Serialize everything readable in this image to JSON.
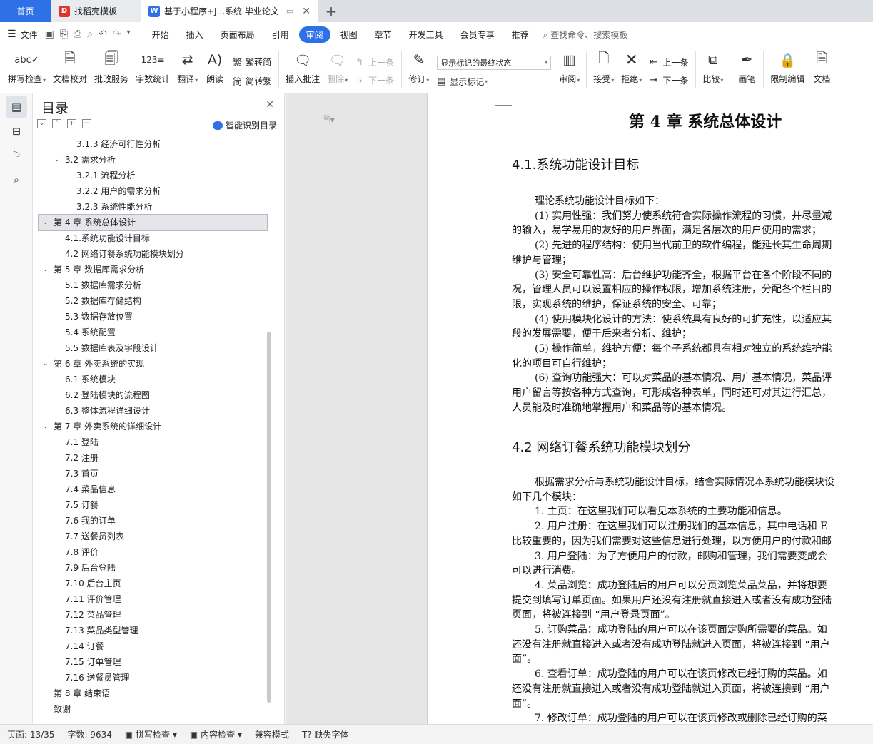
{
  "tabs": [
    {
      "label": "首页"
    },
    {
      "label": "找稻壳模板"
    },
    {
      "label": "基于小程序+J...系统 毕业论文"
    }
  ],
  "menu": {
    "file": "文件",
    "items": [
      "开始",
      "插入",
      "页面布局",
      "引用",
      "审阅",
      "视图",
      "章节",
      "开发工具",
      "会员专享",
      "推荐"
    ],
    "active": "审阅",
    "search": "查找命令、搜索模板"
  },
  "ribbon": {
    "spell": "拼写检查",
    "proof": "文档校对",
    "annotate_service": "批改服务",
    "word_count": "字数统计",
    "translate": "翻译",
    "read": "朗读",
    "trad": "繁转简",
    "simp": "简转繁",
    "insert_comment": "插入批注",
    "delete": "删除",
    "prev1": "上一条",
    "next1": "下一条",
    "revise": "修订",
    "show_markup_select": "显示标记的最终状态",
    "show_markup": "显示标记",
    "review": "审阅",
    "accept": "接受",
    "reject": "拒绝",
    "prev2": "上一条",
    "next2": "下一条",
    "compare": "比较",
    "pen": "画笔",
    "restrict": "限制编辑",
    "doc_more": "文档"
  },
  "toc": {
    "title": "目录",
    "smart": "智能识别目录",
    "items": [
      {
        "label": "3.1.3 经济可行性分析",
        "level": 3
      },
      {
        "label": "3.2 需求分析",
        "level": 2,
        "caret": true
      },
      {
        "label": "3.2.1 流程分析",
        "level": 3
      },
      {
        "label": "3.2.2 用户的需求分析",
        "level": 3
      },
      {
        "label": "3.2.3 系统性能分析",
        "level": 3
      },
      {
        "label": "第 4 章  系统总体设计",
        "level": 1,
        "caret": true,
        "selected": true
      },
      {
        "label": "4.1.系统功能设计目标",
        "level": 2
      },
      {
        "label": "4.2  网络订餐系统功能模块划分",
        "level": 2
      },
      {
        "label": "第 5 章  数据库需求分析",
        "level": 1,
        "caret": true
      },
      {
        "label": "5.1 数据库需求分析",
        "level": 2
      },
      {
        "label": "5.2 数据库存储结构",
        "level": 2
      },
      {
        "label": "5.3  数据存放位置",
        "level": 2
      },
      {
        "label": "5.4  系统配置",
        "level": 2
      },
      {
        "label": "5.5 数据库表及字段设计",
        "level": 2
      },
      {
        "label": "第 6 章  外卖系统的实现",
        "level": 1,
        "caret": true
      },
      {
        "label": "6.1 系统模块",
        "level": 2
      },
      {
        "label": "6.2  登陆模块的流程图",
        "level": 2
      },
      {
        "label": "6.3  整体流程详细设计",
        "level": 2
      },
      {
        "label": "第 7 章  外卖系统的详细设计",
        "level": 1,
        "caret": true
      },
      {
        "label": "7.1 登陆",
        "level": 2
      },
      {
        "label": "7.2 注册",
        "level": 2
      },
      {
        "label": "7.3 首页",
        "level": 2
      },
      {
        "label": "7.4 菜品信息",
        "level": 2
      },
      {
        "label": "7.5 订餐",
        "level": 2
      },
      {
        "label": "7.6 我的订单",
        "level": 2
      },
      {
        "label": "7.7 送餐员列表",
        "level": 2
      },
      {
        "label": "7.8 评价",
        "level": 2
      },
      {
        "label": "7.9  后台登陆",
        "level": 2
      },
      {
        "label": "7.10  后台主页",
        "level": 2
      },
      {
        "label": "7.11 评价管理",
        "level": 2
      },
      {
        "label": "7.12 菜品管理",
        "level": 2
      },
      {
        "label": "7.13 菜品类型管理",
        "level": 2
      },
      {
        "label": "7.14 订餐",
        "level": 2
      },
      {
        "label": "7.15 订单管理",
        "level": 2
      },
      {
        "label": "7.16 送餐员管理",
        "level": 2
      },
      {
        "label": "第 8 章  结束语",
        "level": 1
      },
      {
        "label": "致谢",
        "level": 1
      }
    ]
  },
  "document": {
    "chapter_title": "第 4 章  系统总体设计",
    "h41": "4.1.系统功能设计目标",
    "sec1": [
      {
        "t": "理论系统功能设计目标如下：",
        "ind": true
      },
      {
        "t": "(1)  实用性强：我们努力使系统符合实际操作流程的习惯，并尽量减",
        "ind": true
      },
      {
        "t": "的输入，易学易用的友好的用户界面，满足各层次的用户使用的需求；",
        "ind": false
      },
      {
        "t": "(2)  先进的程序结构：使用当代前卫的软件编程，能延长其生命周期",
        "ind": true
      },
      {
        "t": "维护与管理；",
        "ind": false
      },
      {
        "t": "(3)  安全可靠性高：后台维护功能齐全，根据平台在各个阶段不同的",
        "ind": true
      },
      {
        "t": "况，管理人员可以设置相应的操作权限，增加系统注册，分配各个栏目的",
        "ind": false
      },
      {
        "t": "限，实现系统的维护，保证系统的安全、可靠；",
        "ind": false
      },
      {
        "t": "(4)  使用模块化设计的方法：使系统具有良好的可扩充性，以适应其",
        "ind": true
      },
      {
        "t": "段的发展需要，便于后来者分析、维护；",
        "ind": false
      },
      {
        "t": "(5)  操作简单，维护方便：每个子系统都具有相对独立的系统维护能",
        "ind": true
      },
      {
        "t": "化的项目可自行维护；",
        "ind": false
      },
      {
        "t": "(6)  查询功能强大：可以对菜品的基本情况、用户基本情况，菜品评",
        "ind": true
      },
      {
        "t": "用户留言等按各种方式查询，可形成各种表单，同时还可对其进行汇总，",
        "ind": false
      },
      {
        "t": "人员能及时准确地掌握用户和菜品等的基本情况。",
        "ind": false
      }
    ],
    "h42": "4.2  网络订餐系统功能模块划分",
    "sec2": [
      {
        "t": "根据需求分析与系统功能设计目标，结合实际情况本系统功能模块设",
        "ind": true
      },
      {
        "t": "如下几个模块：",
        "ind": false
      },
      {
        "t": "1.  主页：在这里我们可以看见本系统的主要功能和信息。",
        "ind": true
      },
      {
        "t": "2.  用户注册：在这里我们可以注册我们的基本信息，其中电话和 E",
        "ind": true
      },
      {
        "t": "比较重要的，因为我们需要对这些信息进行处理，以方便用户的付款和邮",
        "ind": false
      },
      {
        "t": "3.  用户登陆：为了方便用户的付款，邮购和管理，我们需要变成会",
        "ind": true
      },
      {
        "t": "可以进行消费。",
        "ind": false
      },
      {
        "t": "4.  菜品浏览：成功登陆后的用户可以分页浏览菜品菜品，并将想要",
        "ind": true
      },
      {
        "t": "提交到填写订单页面。如果用户还没有注册就直接进入或者没有成功登陆",
        "ind": false
      },
      {
        "t": "页面，将被连接到 “用户登录页面”。",
        "ind": false
      },
      {
        "t": "5.  订购菜品：成功登陆的用户可以在该页面定购所需要的菜品。如",
        "ind": true
      },
      {
        "t": "还没有注册就直接进入或者没有成功登陆就进入页面，将被连接到 “用户",
        "ind": false
      },
      {
        "t": "面”。",
        "ind": false
      },
      {
        "t": "6.  查看订单：成功登陆的用户可以在该页修改已经订购的菜品。如",
        "ind": true
      },
      {
        "t": "还没有注册就直接进入或者没有成功登陆就进入页面，将被连接到 “用户",
        "ind": false
      },
      {
        "t": "面”。",
        "ind": false
      },
      {
        "t": "7.  修改订单：成功登陆的用户可以在该页修改或删除已经订购的菜",
        "ind": true
      }
    ]
  },
  "status": {
    "page": "页面: 13/35",
    "words": "字数: 9634",
    "spell": "拼写检查",
    "content": "内容检查",
    "compat": "兼容模式",
    "missing_font": "缺失字体"
  }
}
